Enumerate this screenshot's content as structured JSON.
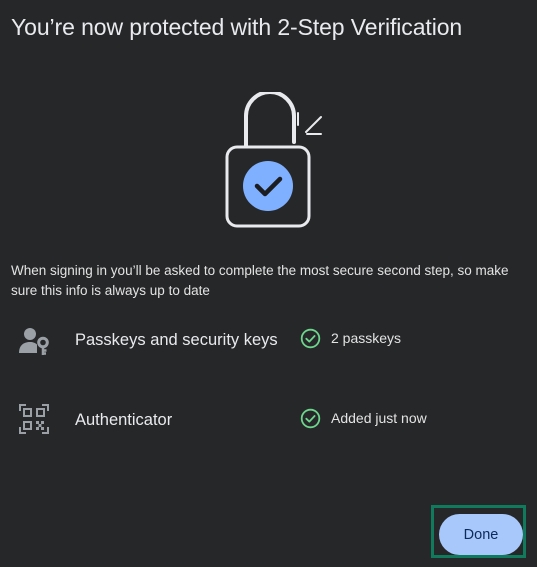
{
  "page": {
    "title": "You’re now protected with 2-Step Verification",
    "description": "When signing in you’ll be asked to complete the most secure second step, so make sure this info is always up to date"
  },
  "methods": [
    {
      "label": "Passkeys and security keys",
      "icon": "person-key-icon",
      "status": "2 passkeys",
      "status_icon": "check-circle-icon"
    },
    {
      "label": "Authenticator",
      "icon": "qr-code-icon",
      "status": "Added just now",
      "status_icon": "check-circle-icon"
    }
  ],
  "actions": {
    "done_label": "Done"
  },
  "colors": {
    "background": "#262729",
    "accent": "#a8c7fa",
    "check_badge": "#7fb0ff",
    "success": "#6dd58c",
    "focus_frame": "#0f7a5c"
  }
}
